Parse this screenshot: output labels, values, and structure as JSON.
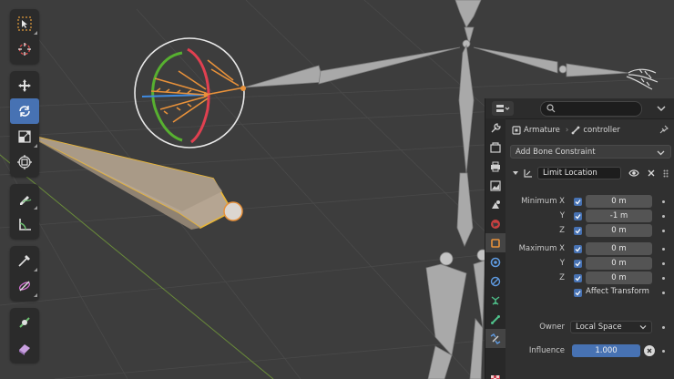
{
  "panel": {
    "breadcrumb": {
      "object": "Armature",
      "separator": "›",
      "bone": "controller"
    },
    "add_constraint_label": "Add Bone Constraint",
    "constraint": {
      "name": "Limit Location",
      "minimum_label": "Minimum X",
      "maximum_label": "Maximum X",
      "axis_y": "Y",
      "axis_z": "Z",
      "min_x": "0 m",
      "min_y": "-1 m",
      "min_z": "0 m",
      "max_x": "0 m",
      "max_y": "0 m",
      "max_z": "0 m",
      "affect_transform_label": "Affect Transform",
      "owner_label": "Owner",
      "owner_value": "Local Space",
      "influence_label": "Influence",
      "influence_value": "1.000"
    }
  },
  "colors": {
    "accent": "#4772b3",
    "bone_gray": "#9a9a9a",
    "selected_outline": "#e6b43a",
    "pose_orange": "#e8913a"
  }
}
